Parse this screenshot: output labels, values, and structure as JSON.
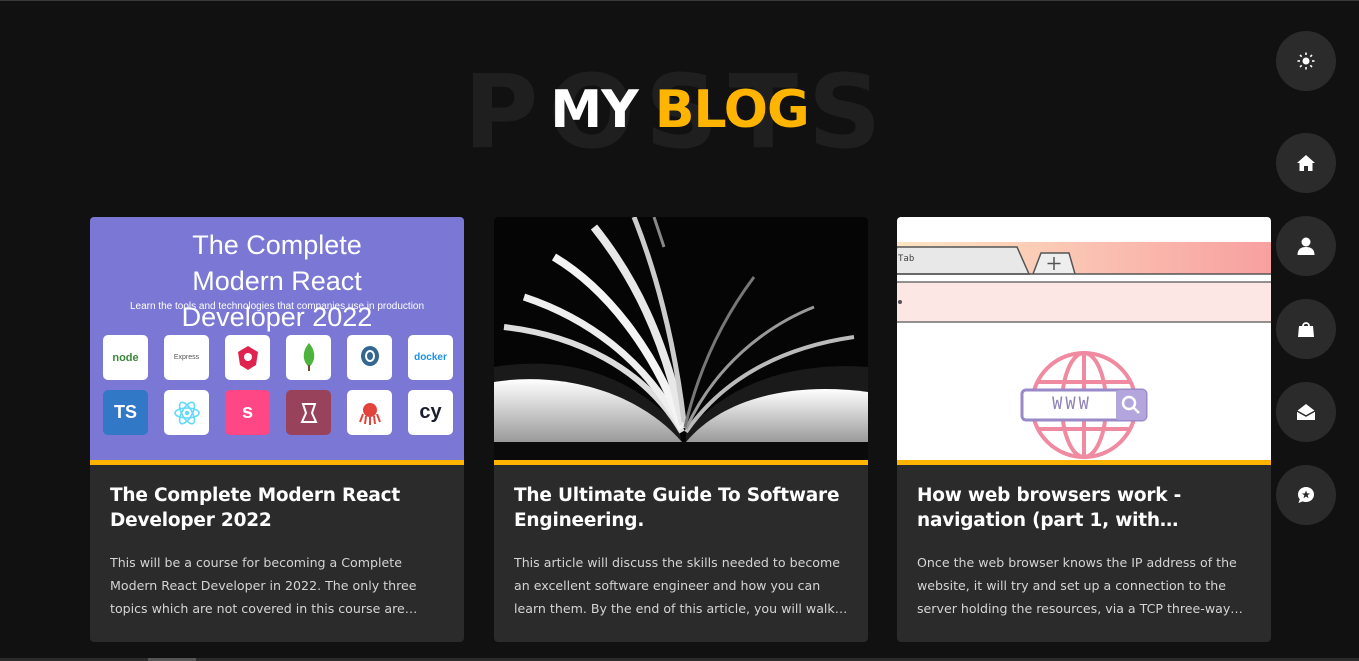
{
  "heading": {
    "background_text": "POSTS",
    "white_word": "MY",
    "accent_word": "BLOG"
  },
  "colors": {
    "accent": "#ffb400",
    "background": "#111111",
    "card": "#2b2b2b",
    "nav_button": "#2b2b2b"
  },
  "posts": [
    {
      "title": "The Complete Modern React Developer 2022",
      "excerpt": "This will be a course for becoming a Complete Modern React Developer in 2022. The only three topics which are not covered in this course are…",
      "image": {
        "headline": "The Complete Modern React Developer 2022",
        "subtitle": "Learn the tools and technologies that companies use in production",
        "logos": [
          "node",
          "Express",
          "nest",
          "mongoDB",
          "PostgreSQL",
          "docker",
          "TS",
          "react",
          "s",
          "jest",
          "octopus",
          "cy"
        ]
      }
    },
    {
      "title": "The Ultimate Guide To Software Engineering.",
      "excerpt": "This article will discuss the skills needed to become an excellent software engineer and how you can learn them. By the end of this article, you will walk…",
      "image": {
        "description": "open-book-photo"
      }
    },
    {
      "title": "How web browsers work - navigation (part 1, with…",
      "excerpt": "Once the web browser knows the IP address of the website, it will try and set up a connection to the server holding the resources, via a TCP three-way…",
      "image": {
        "tab_label": "Tab",
        "search_text": "WWW"
      }
    }
  ],
  "side_nav": [
    {
      "icon": "sun-icon",
      "label": "theme-toggle"
    },
    {
      "icon": "home-icon",
      "label": "home"
    },
    {
      "icon": "user-icon",
      "label": "about"
    },
    {
      "icon": "briefcase-icon",
      "label": "portfolio"
    },
    {
      "icon": "envelope-open-icon",
      "label": "contact"
    },
    {
      "icon": "chat-star-icon",
      "label": "blog"
    }
  ]
}
